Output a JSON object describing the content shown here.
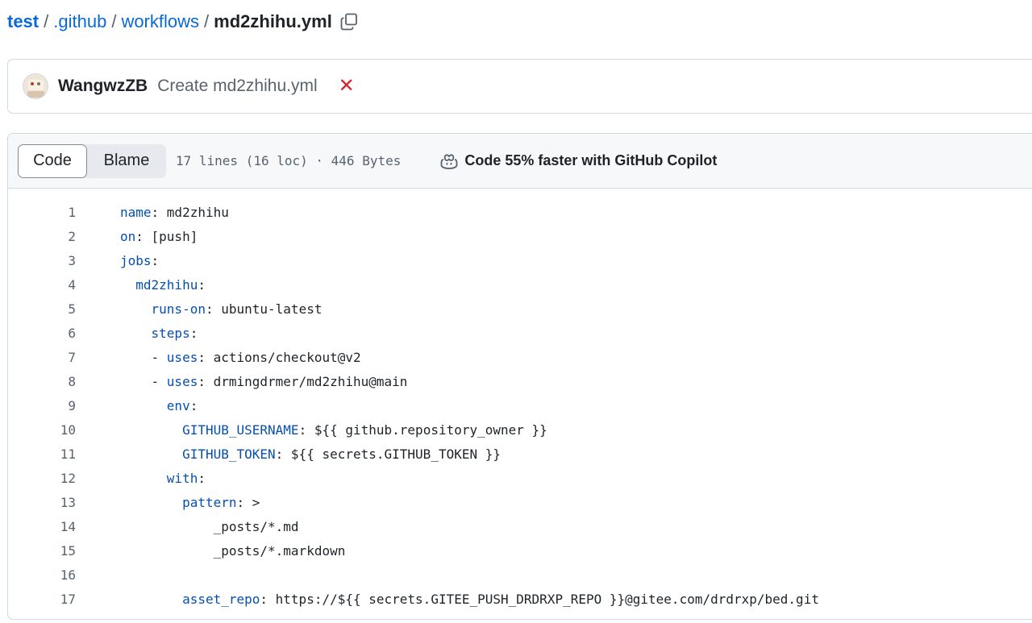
{
  "breadcrumb": {
    "repo": "test",
    "sep1": "/",
    "dir1": ".github",
    "sep2": "/",
    "dir2": "workflows",
    "sep3": "/",
    "file": "md2zhihu.yml"
  },
  "commit": {
    "author": "WangwzZB",
    "message": "Create md2zhihu.yml",
    "status_icon": "x-icon",
    "status_color": "#d1242f"
  },
  "file_header": {
    "tab_code": "Code",
    "tab_blame": "Blame",
    "active_tab": "Code",
    "info": "17 lines (16 loc) · 446 Bytes",
    "copilot": "Code 55% faster with GitHub Copilot"
  },
  "code_lines": [
    {
      "num": "1",
      "indent": "",
      "key": "name",
      "sep": ": ",
      "val": "md2zhihu"
    },
    {
      "num": "2",
      "indent": "",
      "key": "on",
      "sep": ": ",
      "val": "[push]"
    },
    {
      "num": "3",
      "indent": "",
      "key": "jobs",
      "sep": ":",
      "val": ""
    },
    {
      "num": "4",
      "indent": "  ",
      "key": "md2zhihu",
      "sep": ":",
      "val": ""
    },
    {
      "num": "5",
      "indent": "    ",
      "key": "runs-on",
      "sep": ": ",
      "val": "ubuntu-latest"
    },
    {
      "num": "6",
      "indent": "    ",
      "key": "steps",
      "sep": ":",
      "val": ""
    },
    {
      "num": "7",
      "indent": "    - ",
      "key": "uses",
      "sep": ": ",
      "val": "actions/checkout@v2"
    },
    {
      "num": "8",
      "indent": "    - ",
      "key": "uses",
      "sep": ": ",
      "val": "drmingdrmer/md2zhihu@main"
    },
    {
      "num": "9",
      "indent": "      ",
      "key": "env",
      "sep": ":",
      "val": ""
    },
    {
      "num": "10",
      "indent": "        ",
      "key": "GITHUB_USERNAME",
      "sep": ": ",
      "val": "${{ github.repository_owner }}"
    },
    {
      "num": "11",
      "indent": "        ",
      "key": "GITHUB_TOKEN",
      "sep": ": ",
      "val": "${{ secrets.GITHUB_TOKEN }}"
    },
    {
      "num": "12",
      "indent": "      ",
      "key": "with",
      "sep": ":",
      "val": ""
    },
    {
      "num": "13",
      "indent": "        ",
      "key": "pattern",
      "sep": ": ",
      "val": ">"
    },
    {
      "num": "14",
      "indent": "            ",
      "key": "",
      "sep": "",
      "val": "_posts/*.md"
    },
    {
      "num": "15",
      "indent": "            ",
      "key": "",
      "sep": "",
      "val": "_posts/*.markdown"
    },
    {
      "num": "16",
      "indent": "",
      "key": "",
      "sep": "",
      "val": ""
    },
    {
      "num": "17",
      "indent": "        ",
      "key": "asset_repo",
      "sep": ": ",
      "val": "https://${{ secrets.GITEE_PUSH_DRDRXP_REPO }}@gitee.com/drdrxp/bed.git"
    }
  ],
  "icons": {
    "copy": "copy-icon",
    "copilot": "copilot-icon",
    "avatar": "user-avatar"
  },
  "colors": {
    "link": "#0969da",
    "yaml_key": "#0550ae",
    "error": "#d1242f"
  }
}
